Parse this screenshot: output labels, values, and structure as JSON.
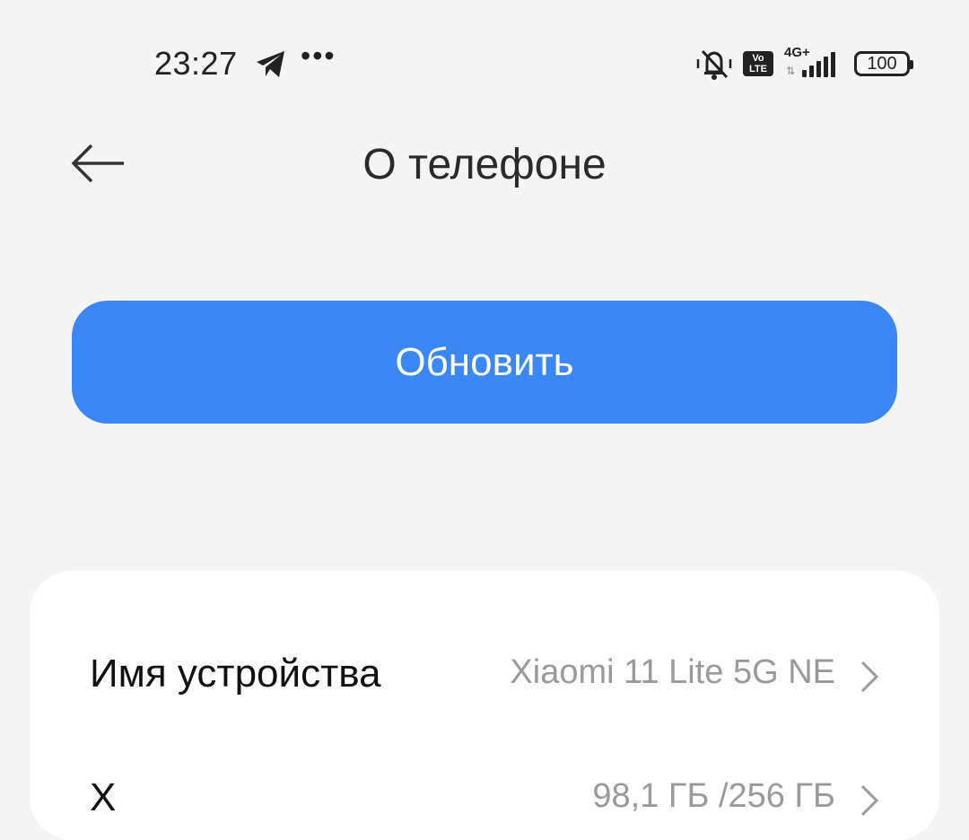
{
  "status_bar": {
    "time": "23:27",
    "network_label": "4G+",
    "volte_label_top": "Vo",
    "volte_label_bottom": "LTE",
    "battery": "100",
    "overflow": "•••"
  },
  "header": {
    "title": "О телефоне"
  },
  "update_button": {
    "label": "Обновить",
    "color": "#3a87f5"
  },
  "rows": [
    {
      "label": "Имя устройства",
      "value": "Xiaomi 11 Lite 5G NE"
    },
    {
      "label": "Х",
      "value": "98,1 ГБ /256 ГБ"
    }
  ]
}
